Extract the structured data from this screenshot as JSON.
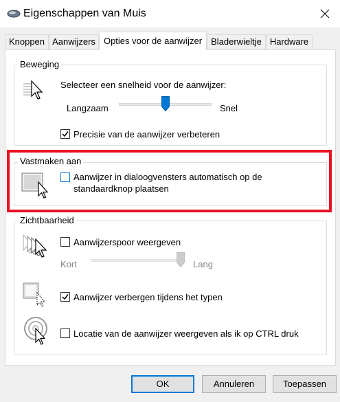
{
  "window": {
    "title": "Eigenschappen van Muis",
    "close_symbol": "×"
  },
  "tabs": [
    {
      "label": "Knoppen",
      "active": false
    },
    {
      "label": "Aanwijzers",
      "active": false
    },
    {
      "label": "Opties voor de aanwijzer",
      "active": true
    },
    {
      "label": "Bladerwieltje",
      "active": false
    },
    {
      "label": "Hardware",
      "active": false
    }
  ],
  "motion": {
    "legend": "Beweging",
    "prompt": "Selecteer een snelheid voor de aanwijzer:",
    "slow_label": "Langzaam",
    "fast_label": "Snel",
    "speed_fraction": 0.5,
    "precision_label": "Precisie van de aanwijzer verbeteren",
    "precision_checked": true
  },
  "snap_to": {
    "legend": "Vastmaken aan",
    "label": "Aanwijzer in dialoogvensters automatisch op de standaardknop plaatsen",
    "line1": "Aanwijzer in dialoogvensters automatisch op de",
    "line2": "standaardknop plaatsen",
    "checked": false
  },
  "visibility": {
    "legend": "Zichtbaarheid",
    "trails_label": "Aanwijzerspoor weergeven",
    "trails_checked": false,
    "short_label": "Kort",
    "long_label": "Lang",
    "trail_fraction": 1.0,
    "hide_typing_label": "Aanwijzer verbergen tijdens het typen",
    "hide_typing_checked": true,
    "ctrl_location_label": "Locatie van de aanwijzer weergeven als ik op CTRL druk",
    "ctrl_location_checked": false
  },
  "buttons": {
    "ok": "OK",
    "cancel": "Annuleren",
    "apply": "Toepassen"
  },
  "colors": {
    "highlight": "#e81123",
    "accent": "#0078d7"
  }
}
